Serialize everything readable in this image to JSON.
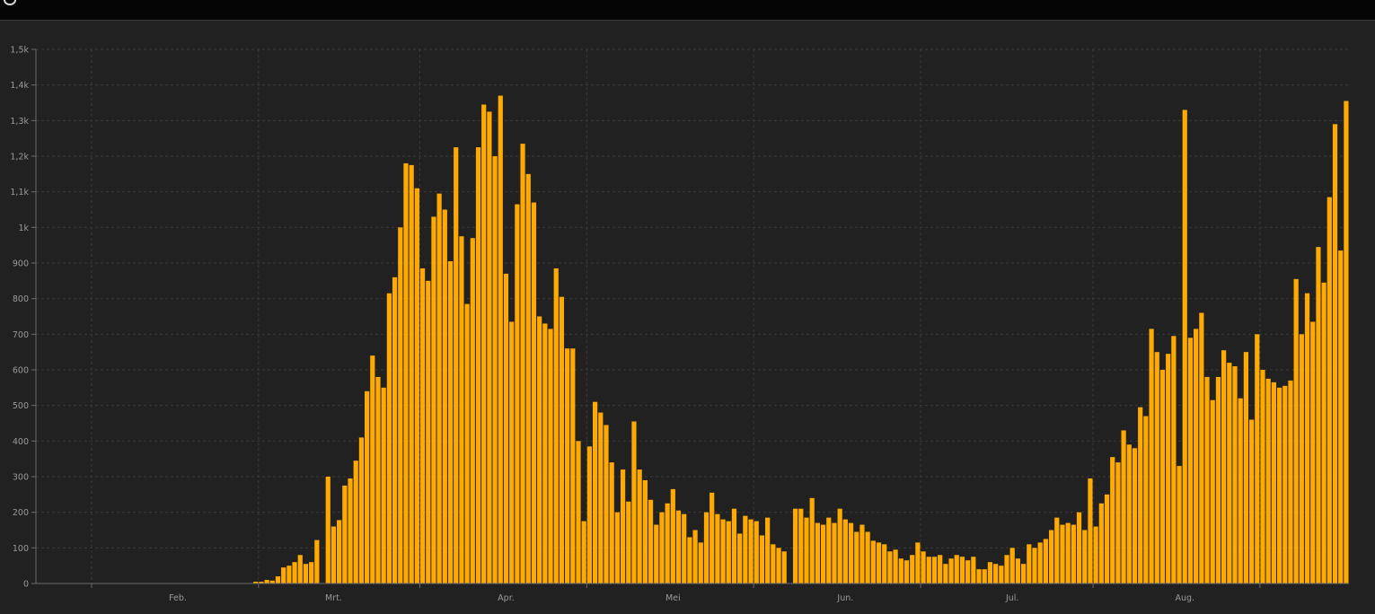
{
  "header": {
    "logo_icon": "globe-icon"
  },
  "chart_data": {
    "type": "bar",
    "color": "#FFAA00",
    "background": "#212121",
    "grid": true,
    "title": "",
    "xlabel": "",
    "ylabel": "",
    "ylim": [
      0,
      1500
    ],
    "yticks": [
      0,
      100,
      200,
      300,
      400,
      500,
      600,
      700,
      800,
      900,
      1000,
      1100,
      1200,
      1300,
      1400,
      1500
    ],
    "ytick_labels": [
      "0",
      "100",
      "200",
      "300",
      "400",
      "500",
      "600",
      "700",
      "800",
      "900",
      "1k",
      "1,1k",
      "1,2k",
      "1,3k",
      "1,4k",
      "1,5k"
    ],
    "xtick_labels": [
      {
        "label": "Feb.",
        "index": 25
      },
      {
        "label": "Mrt.",
        "index": 53
      },
      {
        "label": "Apr.",
        "index": 84
      },
      {
        "label": "Mei",
        "index": 114
      },
      {
        "label": "Jun.",
        "index": 145
      },
      {
        "label": "Jul.",
        "index": 175
      },
      {
        "label": "Aug.",
        "index": 206
      }
    ],
    "month_boundaries": [
      10,
      40,
      69,
      99,
      129,
      159,
      190,
      220
    ],
    "values": [
      0,
      0,
      0,
      0,
      0,
      0,
      0,
      0,
      0,
      0,
      0,
      0,
      0,
      0,
      0,
      0,
      0,
      0,
      0,
      0,
      0,
      0,
      0,
      0,
      0,
      0,
      0,
      0,
      0,
      0,
      0,
      0,
      0,
      0,
      0,
      0,
      0,
      0,
      0,
      5,
      5,
      10,
      8,
      20,
      45,
      50,
      60,
      80,
      55,
      60,
      122,
      0,
      300,
      160,
      178,
      275,
      295,
      345,
      410,
      540,
      640,
      580,
      550,
      815,
      860,
      1000,
      1180,
      1175,
      1110,
      885,
      850,
      1030,
      1095,
      1050,
      905,
      1225,
      975,
      785,
      970,
      1225,
      1345,
      1325,
      1200,
      1370,
      870,
      735,
      1065,
      1235,
      1150,
      1070,
      750,
      730,
      715,
      885,
      805,
      660,
      660,
      400,
      175,
      385,
      510,
      480,
      445,
      340,
      200,
      320,
      230,
      455,
      320,
      290,
      235,
      165,
      200,
      225,
      265,
      205,
      195,
      130,
      150,
      115,
      200,
      255,
      195,
      180,
      175,
      210,
      140,
      190,
      180,
      175,
      135,
      185,
      110,
      100,
      90,
      0,
      210,
      210,
      185,
      240,
      170,
      165,
      185,
      170,
      210,
      180,
      170,
      145,
      165,
      145,
      120,
      115,
      110,
      90,
      95,
      70,
      65,
      80,
      115,
      90,
      75,
      75,
      80,
      55,
      70,
      80,
      75,
      65,
      75,
      40,
      40,
      60,
      55,
      50,
      80,
      100,
      70,
      55,
      110,
      100,
      115,
      125,
      150,
      185,
      165,
      170,
      165,
      200,
      150,
      295,
      160,
      225,
      250,
      355,
      340,
      430,
      390,
      380,
      495,
      470,
      715,
      650,
      600,
      645,
      695,
      330,
      1330,
      690,
      715,
      760,
      580,
      515,
      580,
      655,
      620,
      610,
      520,
      650,
      460,
      700,
      600,
      575,
      565,
      550,
      555,
      570,
      855,
      700,
      815,
      735,
      945,
      845,
      1085,
      1290,
      935,
      1355
    ]
  }
}
